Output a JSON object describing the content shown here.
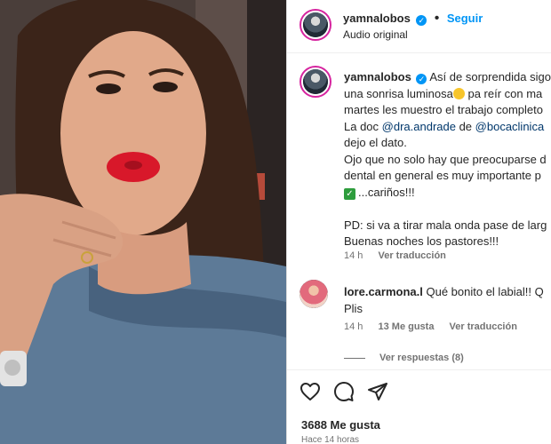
{
  "post_header": {
    "username": "yamnalobos",
    "follow_label": "Seguir",
    "audio_label": "Audio original",
    "dot": "•"
  },
  "caption": {
    "username": "yamnalobos",
    "line1": "Así de sorprendida sigo",
    "line2": "una sonrisa luminosa",
    "line2b": " pa reír con ma",
    "line3": "martes les muestro el trabajo completo",
    "line4a": "La doc ",
    "mention1": "@dra.andrade",
    "line4b": " de ",
    "mention2": "@bocaclinica",
    "line5": "dejo el dato.",
    "line6": "Ojo que no solo hay que preocuparse d",
    "line7": "dental en general es muy importante p",
    "line8": "...cariños!!!",
    "line9": "PD: si va a tirar mala onda pase de larg",
    "line10": "Buenas noches los pastores!!!",
    "time": "14 h",
    "translate": "Ver traducción"
  },
  "comment": {
    "username": "lore.carmona.l",
    "text": " Qué bonito el labial!! Q",
    "text2": "Plis",
    "time": "14 h",
    "likes": "13 Me gusta",
    "translate": "Ver traducción",
    "replies": "Ver respuestas (8)"
  },
  "footer": {
    "likes": "3688 Me gusta",
    "time": "Hace 14 horas"
  },
  "colors": {
    "accent": "#0095f6",
    "mention": "#00376b",
    "muted": "#737373",
    "lips": "#d8182a"
  },
  "icons": {
    "like": "heart-icon",
    "comment": "comment-icon",
    "share": "paper-plane-icon",
    "verified": "verified-badge-icon",
    "check": "check-emoji-icon",
    "emoji": "grin-emoji-icon"
  }
}
